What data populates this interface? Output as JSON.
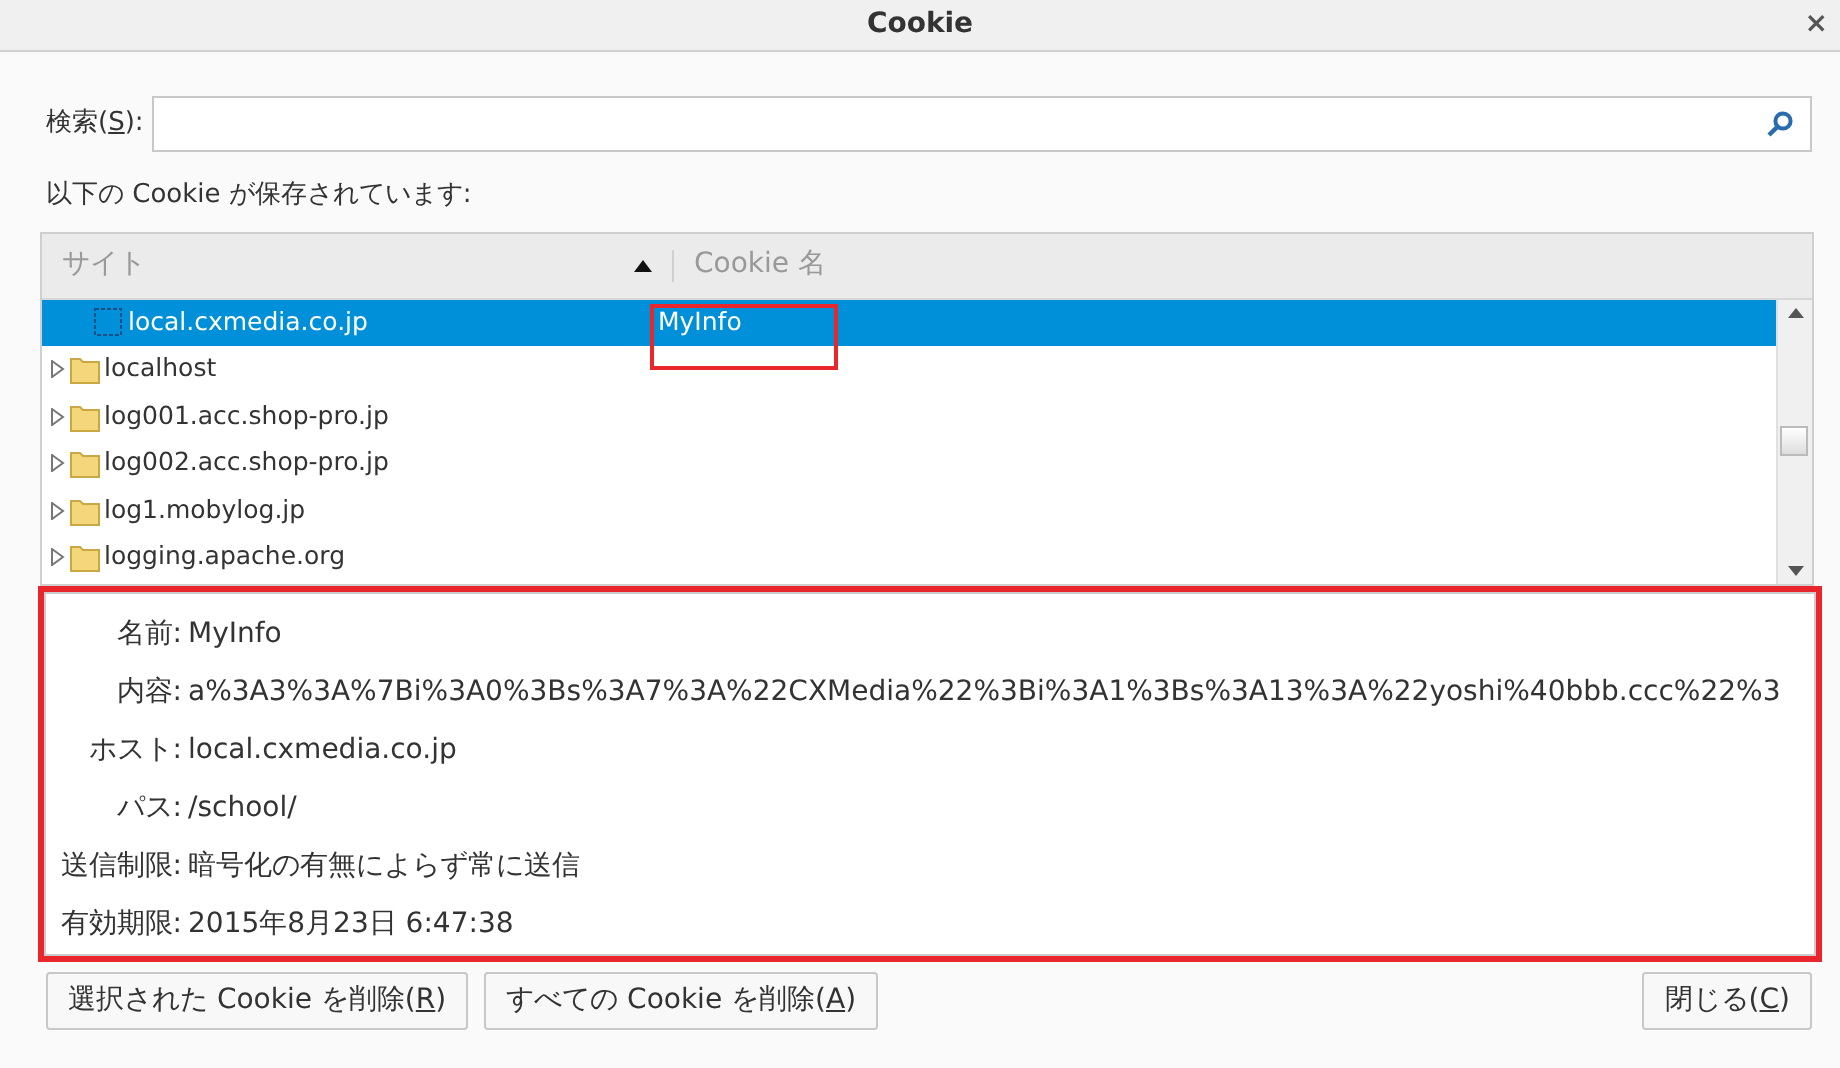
{
  "window": {
    "title": "Cookie",
    "close": "×"
  },
  "search": {
    "label": {
      "before": "検索(",
      "key": "S",
      "after": "):"
    }
  },
  "list_caption": "以下の Cookie が保存されています:",
  "tree": {
    "columns": [
      {
        "label": "サイト",
        "sorted": true
      },
      {
        "label": "Cookie 名",
        "sorted": false
      }
    ],
    "rows": [
      {
        "kind": "cookie",
        "site": "local.cxmedia.co.jp",
        "cookie_name": "MyInfo",
        "selected": true,
        "highlighted": true
      },
      {
        "kind": "folder",
        "site": "localhost",
        "selected": false,
        "highlighted": false
      },
      {
        "kind": "folder",
        "site": "log001.acc.shop-pro.jp",
        "selected": false,
        "highlighted": false
      },
      {
        "kind": "folder",
        "site": "log002.acc.shop-pro.jp",
        "selected": false,
        "highlighted": false
      },
      {
        "kind": "folder",
        "site": "log1.mobylog.jp",
        "selected": false,
        "highlighted": false
      },
      {
        "kind": "folder",
        "site": "logging.apache.org",
        "selected": false,
        "highlighted": false
      }
    ]
  },
  "details": {
    "highlighted": true,
    "fields": [
      {
        "label": "名前:",
        "value": "MyInfo"
      },
      {
        "label": "内容:",
        "value": "a%3A3%3A%7Bi%3A0%3Bs%3A7%3A%22CXMedia%22%3Bi%3A1%3Bs%3A13%3A%22yoshi%40bbb.ccc%22%3"
      },
      {
        "label": "ホスト:",
        "value": "local.cxmedia.co.jp"
      },
      {
        "label": "パス:",
        "value": "/school/"
      },
      {
        "label": "送信制限:",
        "value": "暗号化の有無によらず常に送信"
      },
      {
        "label": "有効期限:",
        "value": "2015年8月23日 6:47:38"
      }
    ]
  },
  "buttons": [
    {
      "before": "選択された Cookie を削除(",
      "key": "R",
      "after": ")"
    },
    {
      "before": "すべての Cookie を削除(",
      "key": "A",
      "after": ")"
    },
    {
      "before": "閉じる(",
      "key": "C",
      "after": ")"
    }
  ]
}
